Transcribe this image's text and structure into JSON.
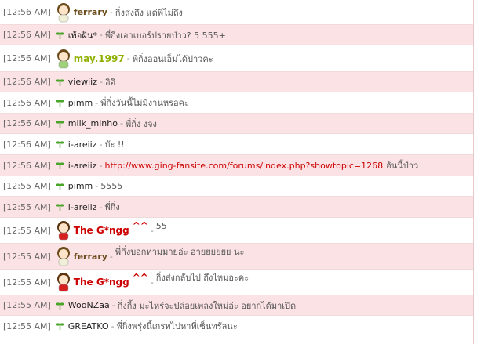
{
  "chat": {
    "separator": "-",
    "messages": [
      {
        "time": "[12:56 AM]",
        "user": "ferrary",
        "avatar": "girl-avatar-icon",
        "text": "กิ่งส่งถึง แต่พี่ไม่ถึง"
      },
      {
        "time": "[12:56 AM]",
        "user": "เพ้อฝัน*",
        "avatar": "sprout-icon",
        "text": "พี่กิ่งเอาเบอร์ปรายป่าว? 5 555+"
      },
      {
        "time": "[12:56 AM]",
        "user": "may.1997",
        "avatar": "girl-avatar-icon",
        "text": "พี่กิ่งออนเอ็มได้ป่าวคะ"
      },
      {
        "time": "[12:56 AM]",
        "user": "viewiiz",
        "avatar": "sprout-icon",
        "text": "อิอิ"
      },
      {
        "time": "[12:56 AM]",
        "user": "pimm",
        "avatar": "sprout-icon",
        "text": "พี่กิ่งวันนี้ไม่มีงานหรอคะ"
      },
      {
        "time": "[12:56 AM]",
        "user": "milk_minho",
        "avatar": "sprout-icon",
        "text": "พี่กิ่ง งจง"
      },
      {
        "time": "[12:56 AM]",
        "user": "i-areiiz",
        "avatar": "sprout-icon",
        "text": "บัะ !!"
      },
      {
        "time": "[12:56 AM]",
        "user": "i-areiiz",
        "avatar": "sprout-icon",
        "link": "http://www.ging-fansite.com/forums/index.php?showtopic=1268",
        "text": "อันนี้ป่าว"
      },
      {
        "time": "[12:55 AM]",
        "user": "pimm",
        "avatar": "sprout-icon",
        "text": "5555"
      },
      {
        "time": "[12:55 AM]",
        "user": "i-areiiz",
        "avatar": "sprout-icon",
        "text": "พี่กิ่ง"
      },
      {
        "time": "[12:55 AM]",
        "user": "The G*ngg",
        "user_suffix": "^^",
        "avatar": "girl-avatar-icon",
        "text": "55"
      },
      {
        "time": "[12:55 AM]",
        "user": "ferrary",
        "avatar": "girl-avatar-icon",
        "text": "พี่กิ่งบอกทามมายอ่ะ อายยยยยย นะ"
      },
      {
        "time": "[12:55 AM]",
        "user": "The G*ngg",
        "user_suffix": "^^",
        "avatar": "girl-avatar-icon",
        "text": "กิ่งส่งกลับไป ถึงไหมอะคะ"
      },
      {
        "time": "[12:55 AM]",
        "user": "WooNZaa",
        "avatar": "sprout-icon",
        "text": "กิ่งกิ้ง มะไหร่จะปล่อยเพลงใหม่อ่ะ อยากได้มาเปิด"
      },
      {
        "time": "[12:55 AM]",
        "user": "GREATKO",
        "avatar": "sprout-icon",
        "text": "พี่กิ่งพรุ่งนี้เกรทไปหาที่เซ็นทรัลนะ"
      }
    ]
  }
}
